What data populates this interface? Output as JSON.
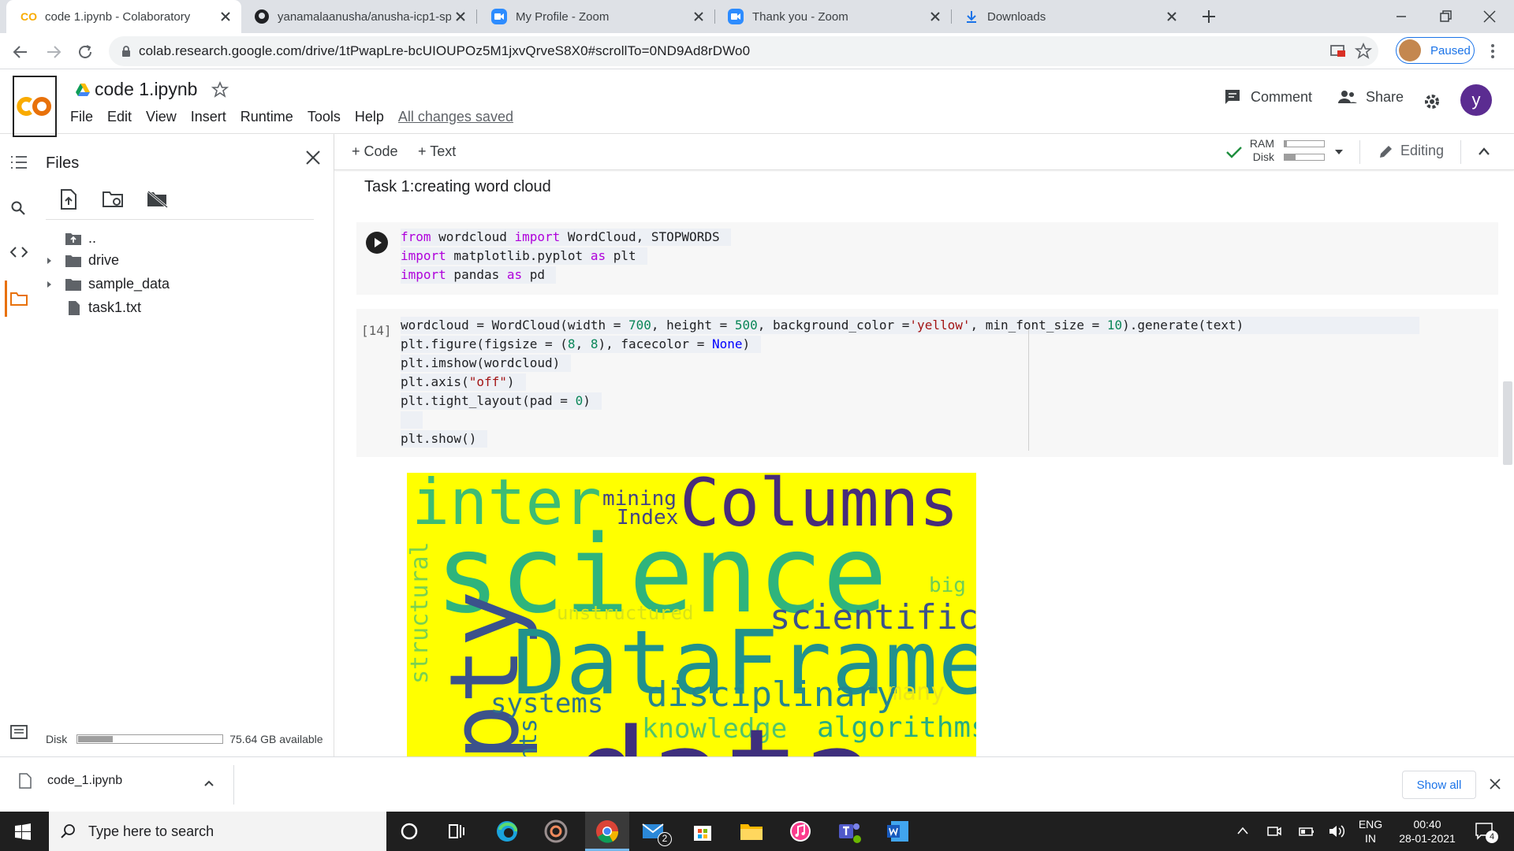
{
  "browser": {
    "tabs": [
      {
        "title": "code 1.ipynb - Colaboratory",
        "icon": "colab-icon",
        "active": true
      },
      {
        "title": "yanamalaanusha/anusha-icp1-sp",
        "icon": "github-icon",
        "active": false
      },
      {
        "title": "My Profile - Zoom",
        "icon": "zoom-icon",
        "active": false
      },
      {
        "title": "Thank you - Zoom",
        "icon": "zoom-icon",
        "active": false
      },
      {
        "title": "Downloads",
        "icon": "download-icon",
        "active": false
      }
    ],
    "url": "colab.research.google.com/drive/1tPwapLre-bcUIOUPOz5M1jxvQrveS8X0#scrollTo=0ND9Ad8rDWo0",
    "profile_status": "Paused"
  },
  "colab": {
    "notebook_title": "code 1.ipynb",
    "menu": [
      "File",
      "Edit",
      "View",
      "Insert",
      "Runtime",
      "Tools",
      "Help"
    ],
    "save_status": "All changes saved",
    "comment_label": "Comment",
    "share_label": "Share",
    "avatar_letter": "y",
    "add_code_label": "Code",
    "add_text_label": "Text",
    "ram_label": "RAM",
    "disk_label": "Disk",
    "mode_label": "Editing"
  },
  "files_panel": {
    "title": "Files",
    "tree": [
      {
        "name": "..",
        "type": "up"
      },
      {
        "name": "drive",
        "type": "folder"
      },
      {
        "name": "sample_data",
        "type": "folder"
      },
      {
        "name": "task1.txt",
        "type": "file"
      }
    ],
    "disk_label": "Disk",
    "disk_usage_fraction": 0.24,
    "disk_available": "75.64 GB available"
  },
  "notebook": {
    "text_cell": "Task 1:creating word cloud",
    "cell1": {
      "lines": [
        "from wordcloud import WordCloud, STOPWORDS",
        "import matplotlib.pyplot as plt",
        "import pandas as pd"
      ]
    },
    "cell2": {
      "exec_count": "[14]",
      "lines": [
        "wordcloud = WordCloud(width = 700, height = 500, background_color ='yellow', min_font_size = 10).generate(text)",
        "plt.figure(figsize = (8, 8), facecolor = None)",
        "plt.imshow(wordcloud)",
        "plt.axis(\"off\")",
        "plt.tight_layout(pad = 0)",
        "",
        "plt.show()"
      ]
    },
    "wordcloud": {
      "background": "#ffff00",
      "words": [
        "inter",
        "mining",
        "Index",
        "Columns",
        "science",
        "structural",
        "big",
        "unstructured",
        "scientific",
        "pty",
        "DataFrame",
        "many",
        "systems",
        "disciplinary",
        "nts",
        "knowledge",
        "algorithms",
        "data"
      ]
    }
  },
  "downloads": {
    "file": "code_1.ipynb",
    "show_all": "Show all"
  },
  "taskbar": {
    "search_placeholder": "Type here to search",
    "lang_top": "ENG",
    "lang_bottom": "IN",
    "time": "00:40",
    "date": "28-01-2021",
    "notifications": "4",
    "mail_badge": "2"
  }
}
